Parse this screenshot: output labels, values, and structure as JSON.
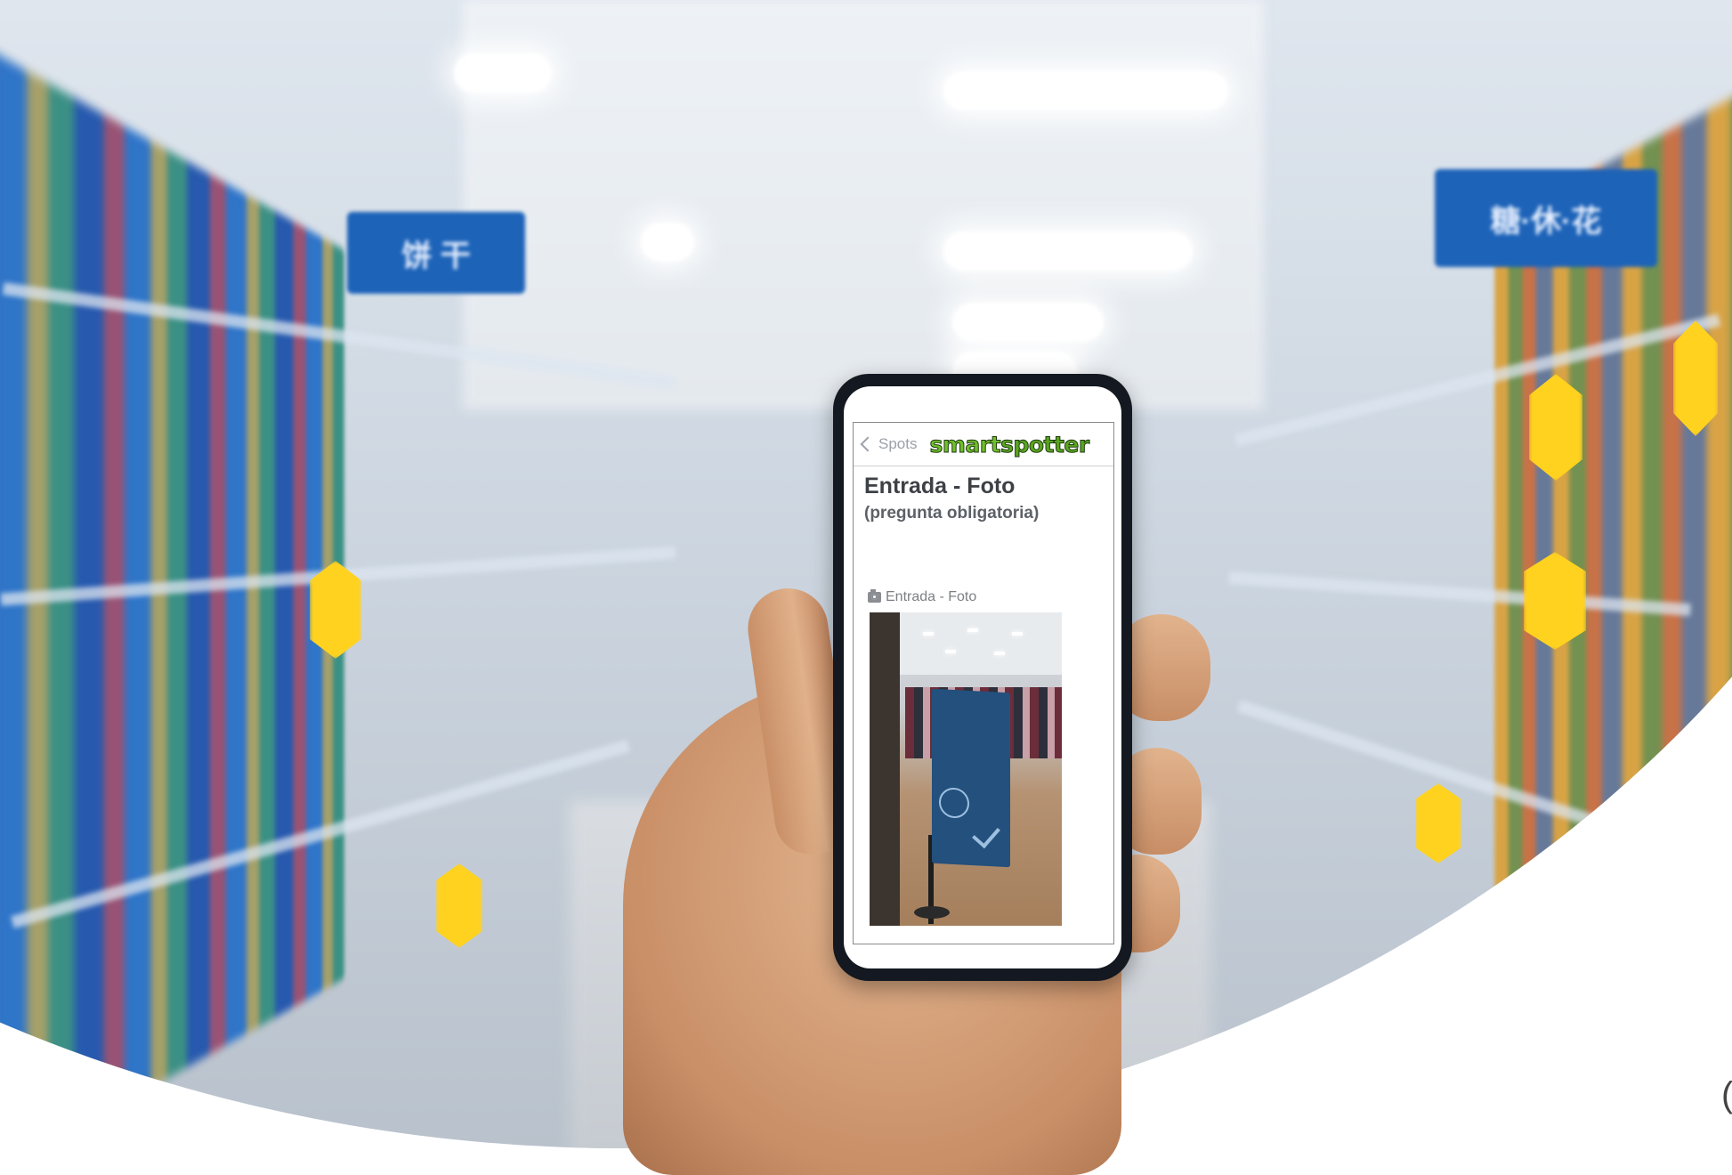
{
  "app": {
    "back_label": "Spots",
    "logo_part1": "smart",
    "logo_part2": "spotter"
  },
  "question": {
    "title": "Entrada - Foto",
    "subtitle": "(pregunta obligatoria)",
    "field_label": "Entrada - Foto",
    "field_icon": "camera-icon"
  },
  "background": {
    "aisle_sign_left": "饼 干",
    "aisle_sign_right": "糖·休·花"
  },
  "colors": {
    "logo_green": "#6fbf2a",
    "phone_body": "#141820",
    "aisle_sign_blue": "#1d63b8",
    "price_tag_yellow": "#ffd21f"
  }
}
